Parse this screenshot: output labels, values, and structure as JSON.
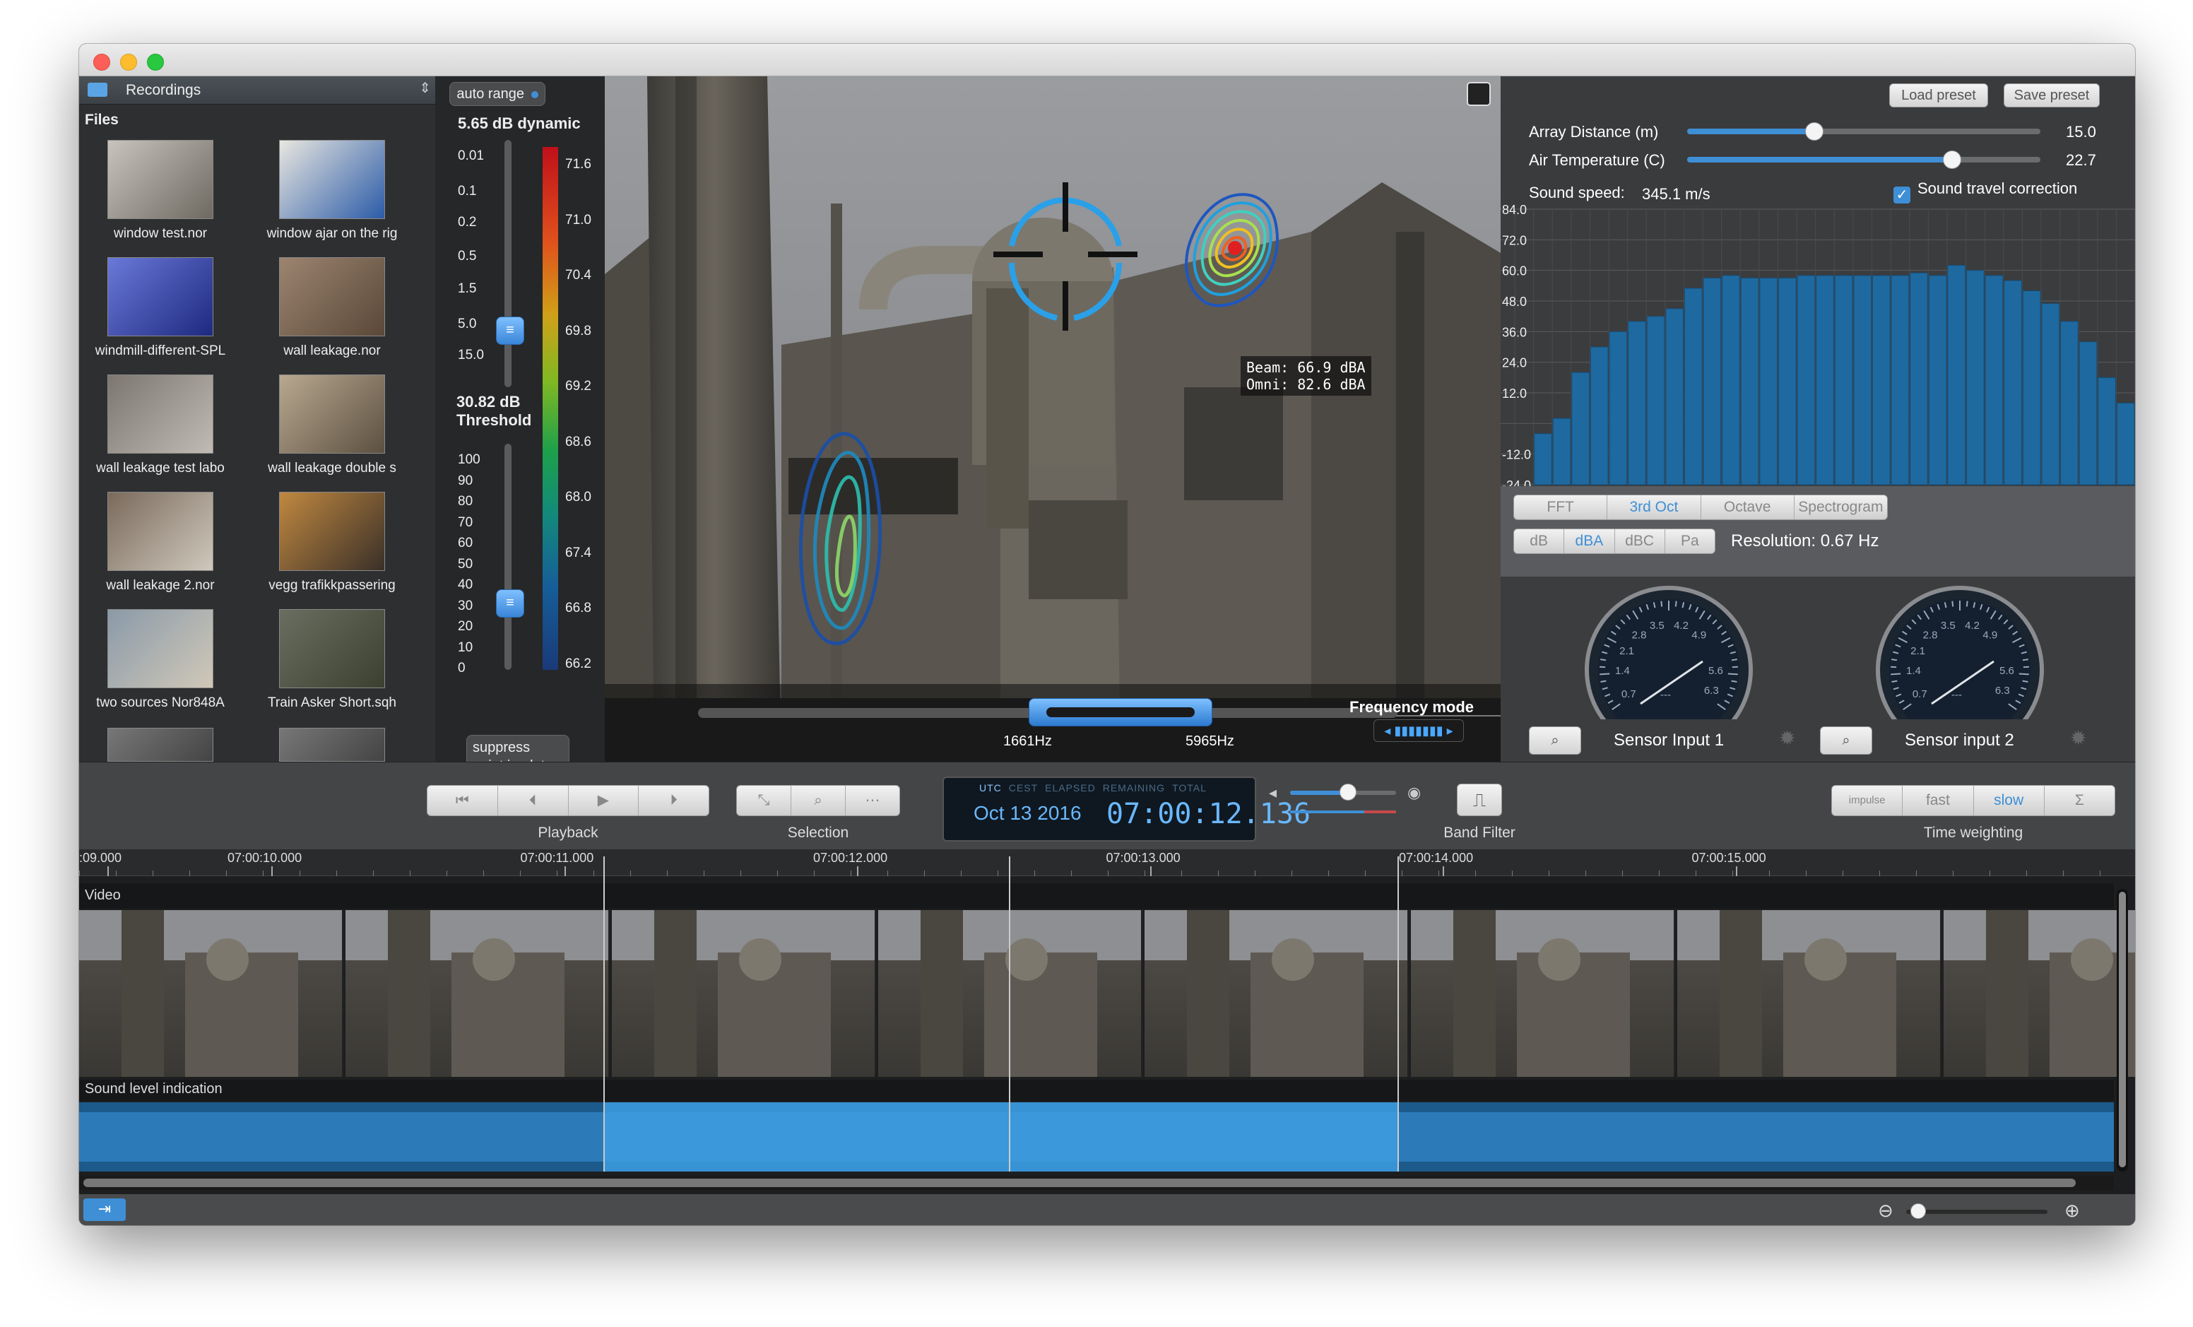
{
  "window": {
    "controls": [
      "close",
      "minimize",
      "zoom"
    ]
  },
  "sidebar": {
    "source_label": "Recordings",
    "files_heading": "Files",
    "files": [
      {
        "name": "window test.nor"
      },
      {
        "name": "window ajar on the rig"
      },
      {
        "name": "windmill-different-SPL"
      },
      {
        "name": "wall leakage.nor"
      },
      {
        "name": "wall leakage test labo"
      },
      {
        "name": "wall leakage double s"
      },
      {
        "name": "wall leakage 2.nor"
      },
      {
        "name": "vegg trafikkpassering"
      },
      {
        "name": "two sources Nor848A"
      },
      {
        "name": "Train Asker Short.sqh"
      }
    ]
  },
  "range_panel": {
    "auto_range_label": "auto range",
    "dynamic_label": "5.65 dB dynamic",
    "dynamic_ticks": [
      "0.01",
      "0.1",
      "0.2",
      "0.5",
      "1.5",
      "5.0",
      "15.0"
    ],
    "threshold_label_1": "30.82 dB",
    "threshold_label_2": "Threshold",
    "threshold_ticks": [
      "100",
      "90",
      "80",
      "70",
      "60",
      "50",
      "40",
      "30",
      "20",
      "10",
      "0"
    ],
    "color_scale": [
      "71.6",
      "71.0",
      "70.4",
      "69.8",
      "69.2",
      "68.6",
      "68.0",
      "67.4",
      "66.8",
      "66.2"
    ],
    "suppress_line1": "suppress",
    "suppress_line2": "point in plot"
  },
  "video": {
    "beam_label": "Beam: 66.9 dBA",
    "omni_label": "Omni: 82.6 dBA",
    "freq_low": "1661Hz",
    "freq_high": "5965Hz",
    "freq_mode_label": "Frequency mode"
  },
  "settings": {
    "load_preset": "Load preset",
    "save_preset": "Save preset",
    "array_distance_label": "Array Distance (m)",
    "array_distance_value": "15.0",
    "array_distance_level": 0.36,
    "air_temp_label": "Air Temperature (C)",
    "air_temp_value": "22.7",
    "air_temp_level": 0.75,
    "sound_speed_label": "Sound speed:",
    "sound_speed_value": "345.1 m/s",
    "travel_correction_label": "Sound travel correction",
    "travel_correction_checked": true
  },
  "chart_data": {
    "type": "bar",
    "ylim": [
      -24,
      84
    ],
    "yticks": [
      "84.0",
      "72.0",
      "60.0",
      "48.0",
      "36.0",
      "24.0",
      "12.0",
      "-12.0",
      "-24.0"
    ],
    "values": [
      -24,
      -4,
      2,
      20,
      30,
      36,
      40,
      42,
      45,
      53,
      57,
      58,
      57,
      57,
      57,
      58,
      58,
      58,
      58,
      58,
      58,
      59,
      58,
      62,
      60,
      58,
      56,
      52,
      47,
      40,
      32,
      18,
      8
    ]
  },
  "analysis_tabs": {
    "items": [
      "FFT",
      "3rd Oct",
      "Octave",
      "Spectrogram"
    ],
    "active": "3rd Oct"
  },
  "weighting_tabs": {
    "items": [
      "dB",
      "dBA",
      "dBC",
      "Pa"
    ],
    "active": "dBA"
  },
  "resolution_label": "Resolution: 0.67 Hz",
  "gauges": {
    "scale_labels": [
      "0.7",
      "1.4",
      "2.1",
      "2.8",
      "3.5",
      "4.2",
      "4.9",
      "5.6",
      "6.3",
      "---"
    ],
    "sensor1": "Sensor Input 1",
    "sensor2": "Sensor input 2"
  },
  "toolbar": {
    "playback_label": "Playback",
    "selection_label": "Selection",
    "band_filter_label": "Band Filter",
    "time_weighting_label": "Time weighting",
    "time_modes": [
      "UTC",
      "CEST",
      "ELAPSED",
      "REMAINING",
      "TOTAL"
    ],
    "date": "Oct 13 2016",
    "time": "07:00:12.136",
    "volume_level": 0.55,
    "weighting_options": [
      "impulse",
      "fast",
      "slow",
      "Σ"
    ],
    "weighting_active": "slow"
  },
  "timeline": {
    "ticks": [
      ":09.000",
      "07:00:10.000",
      "07:00:11.000",
      "07:00:12.000",
      "07:00:13.000",
      "07:00:14.000",
      "07:00:15.000"
    ],
    "video_label": "Video",
    "sound_label": "Sound level indication"
  },
  "colors": {
    "accent": "#3f8fd6",
    "bars": "#1e6aa0",
    "sound": "#2d7ab8",
    "sound_selected": "#3d9ee0"
  }
}
